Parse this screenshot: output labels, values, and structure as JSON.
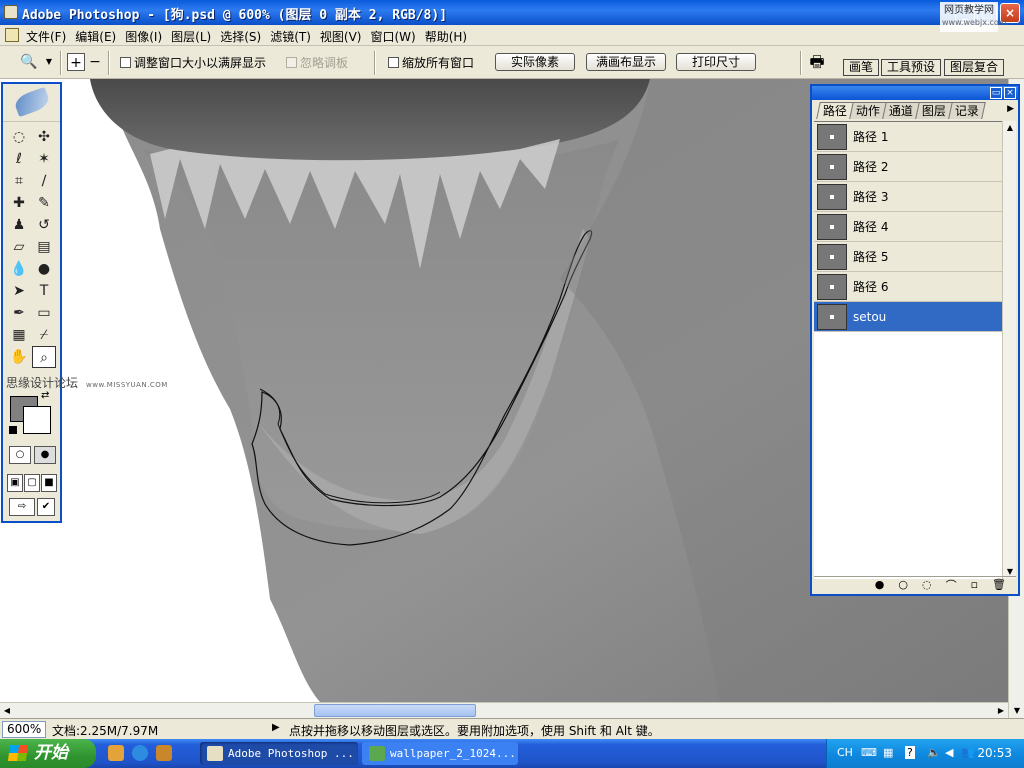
{
  "window": {
    "title": "Adobe Photoshop - [狗.psd @ 600% (图层 0 副本 2, RGB/8)]",
    "watermark_title": "网页教学网",
    "watermark_url": "www.webjx.com"
  },
  "menu": [
    "文件(F)",
    "编辑(E)",
    "图像(I)",
    "图层(L)",
    "选择(S)",
    "滤镜(T)",
    "视图(V)",
    "窗口(W)",
    "帮助(H)"
  ],
  "options": {
    "resize_windows": "调整窗口大小以满屏显示",
    "ignore_palettes": "忽略调板",
    "zoom_all": "缩放所有窗口",
    "actual_pixels": "实际像素",
    "fit_screen": "满画布显示",
    "print_size": "打印尺寸",
    "well_tabs": [
      "画笔",
      "工具预设",
      "图层复合"
    ]
  },
  "toolbox_watermark": {
    "text": "思缘设计论坛",
    "url": "www.MISSYUAN.COM"
  },
  "paths_panel": {
    "tabs": [
      "路径",
      "动作",
      "通道",
      "图层",
      "记录"
    ],
    "paths": [
      {
        "name": "路径 1",
        "selected": false
      },
      {
        "name": "路径 2",
        "selected": false
      },
      {
        "name": "路径 3",
        "selected": false
      },
      {
        "name": "路径 4",
        "selected": false
      },
      {
        "name": "路径 5",
        "selected": false
      },
      {
        "name": "路径 6",
        "selected": false
      },
      {
        "name": "setou",
        "selected": true
      }
    ]
  },
  "status": {
    "zoom": "600%",
    "doc": "文档:2.25M/7.97M",
    "hint": "点按并拖移以移动图层或选区。要用附加选项，使用 Shift 和 Alt 键。"
  },
  "taskbar": {
    "start": "开始",
    "tasks": [
      "Adobe Photoshop ...",
      "wallpaper_2_1024..."
    ],
    "tray_lang": "CH",
    "clock": "20:53"
  },
  "colors": {
    "foreground": "#808080",
    "background": "#ffffff",
    "selection": "#316ac5",
    "titlebar": "#0a5bdc"
  }
}
